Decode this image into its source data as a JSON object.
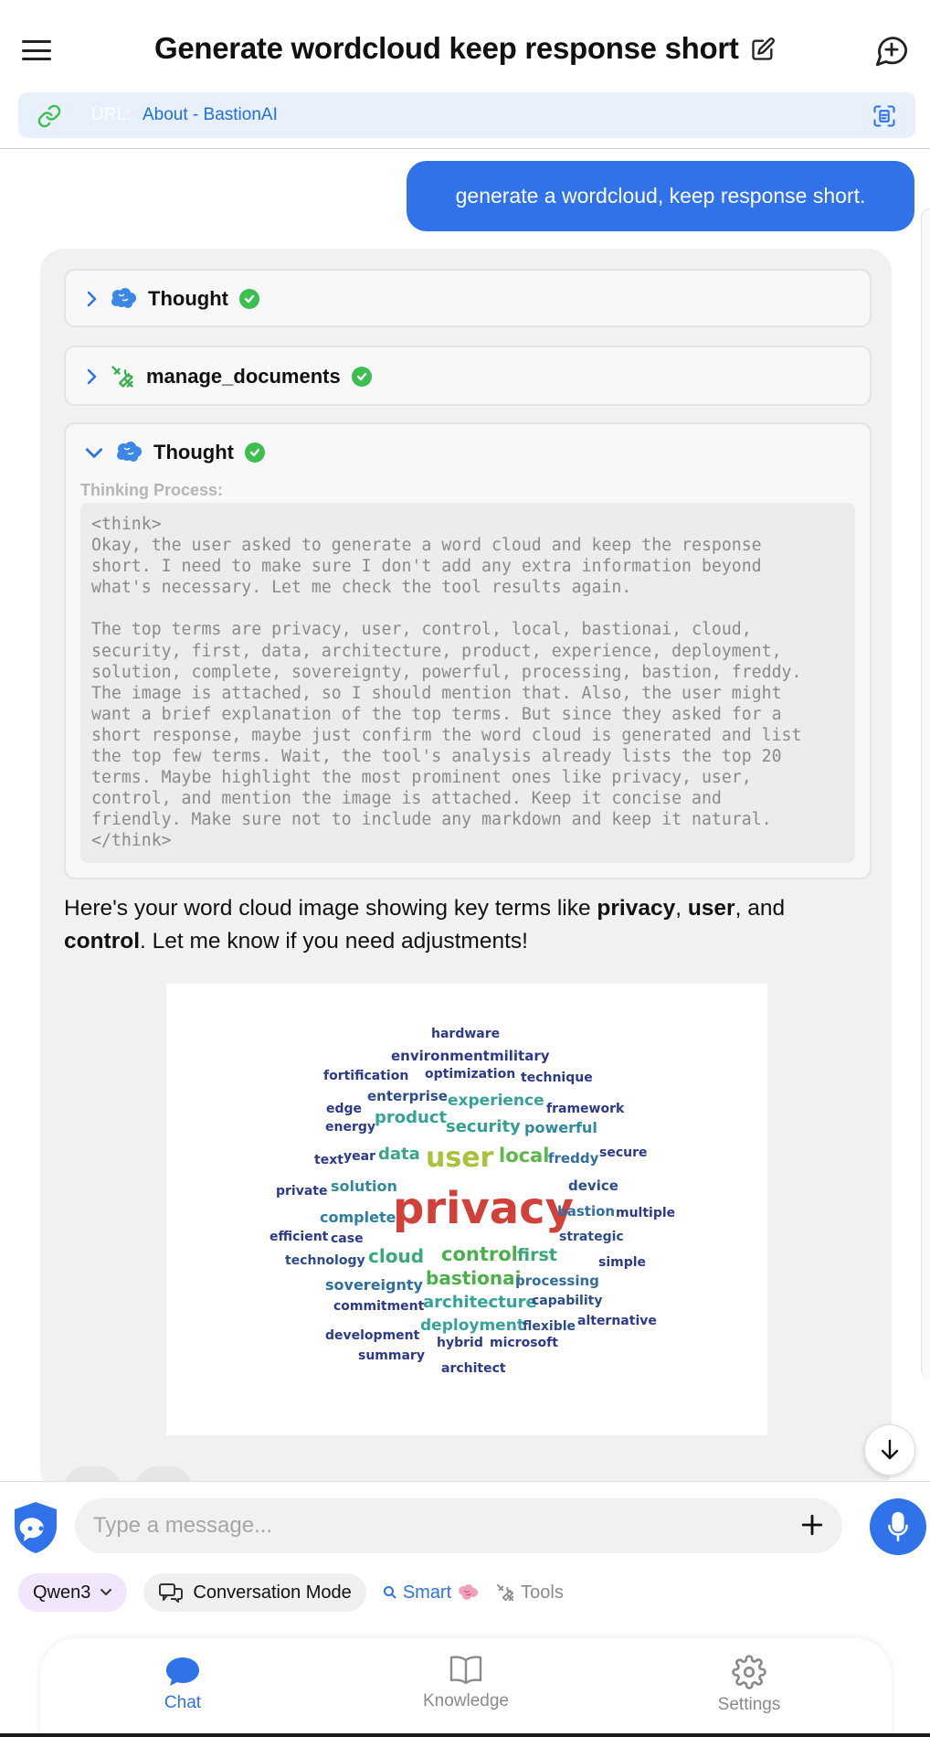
{
  "header": {
    "title": "Generate wordcloud keep response short",
    "menu_icon": "hamburger-menu-icon",
    "edit_icon": "edit-icon",
    "new_chat_icon": "new-chat-icon"
  },
  "url_bar": {
    "label": "URL:",
    "value": "About - BastionAI",
    "link_icon": "link-icon",
    "scan_icon": "scan-icon"
  },
  "user_message": "generate a wordcloud, keep response short.",
  "steps": [
    {
      "name": "Thought",
      "status": "complete",
      "expanded": false,
      "icon": "brain-icon"
    },
    {
      "name": "manage_documents",
      "status": "complete",
      "expanded": false,
      "icon": "tools-icon"
    },
    {
      "name": "Thought",
      "status": "complete",
      "expanded": true,
      "icon": "brain-icon"
    }
  ],
  "thinking": {
    "label": "Thinking Process:",
    "text": "<think>\nOkay, the user asked to generate a word cloud and keep the response\nshort. I need to make sure I don't add any extra information beyond\nwhat's necessary. Let me check the tool results again.\n\nThe top terms are privacy, user, control, local, bastionai, cloud,\nsecurity, first, data, architecture, product, experience, deployment,\nsolution, complete, sovereignty, powerful, processing, bastion, freddy.\nThe image is attached, so I should mention that. Also, the user might\nwant a brief explanation of the top terms. But since they asked for a\nshort response, maybe just confirm the word cloud is generated and list\nthe top few terms. Wait, the tool's analysis already lists the top 20\nterms. Maybe highlight the most prominent ones like privacy, user,\ncontrol, and mention the image is attached. Keep it concise and\nfriendly. Make sure not to include any markdown and keep it natural.\n</think>"
  },
  "answer": {
    "p1": "Here's your word cloud image showing key terms like ",
    "b1": "privacy",
    "p2": ", ",
    "b2": "user",
    "p3": ", and ",
    "b3": "control",
    "p4": ". Let me know if you need adjustments!"
  },
  "wordcloud": {
    "words": [
      {
        "text": "hardware",
        "color": "#2b3a8c"
      },
      {
        "text": "environment",
        "color": "#2b3a8c"
      },
      {
        "text": "military",
        "color": "#2b3a8c"
      },
      {
        "text": "fortification",
        "color": "#2b3a8c"
      },
      {
        "text": "optimization",
        "color": "#2b3a8c"
      },
      {
        "text": "technique",
        "color": "#2b3a8c"
      },
      {
        "text": "enterprise",
        "color": "#2b4d8c"
      },
      {
        "text": "edge",
        "color": "#2b3a8c"
      },
      {
        "text": "experience",
        "color": "#35a39a"
      },
      {
        "text": "framework",
        "color": "#2b3a8c"
      },
      {
        "text": "energy",
        "color": "#2b3a8c"
      },
      {
        "text": "product",
        "color": "#35a39a"
      },
      {
        "text": "security",
        "color": "#34a090"
      },
      {
        "text": "powerful",
        "color": "#2f8a9e"
      },
      {
        "text": "text",
        "color": "#2b3a8c"
      },
      {
        "text": "year",
        "color": "#2b3a8c"
      },
      {
        "text": "data",
        "color": "#38a680"
      },
      {
        "text": "user",
        "color": "#a8c23c"
      },
      {
        "text": "local",
        "color": "#5cb84a"
      },
      {
        "text": "freddy",
        "color": "#2f6e9e"
      },
      {
        "text": "secure",
        "color": "#2b3a8c"
      },
      {
        "text": "private",
        "color": "#2b3a8c"
      },
      {
        "text": "solution",
        "color": "#2f8a9e"
      },
      {
        "text": "device",
        "color": "#2b4d8c"
      },
      {
        "text": "complete",
        "color": "#2f7fa0"
      },
      {
        "text": "privacy",
        "color": "#d2403a"
      },
      {
        "text": "bastion",
        "color": "#2f6e9e"
      },
      {
        "text": "multiple",
        "color": "#2b3a8c"
      },
      {
        "text": "efficient",
        "color": "#2b3a8c"
      },
      {
        "text": "case",
        "color": "#2b3a8c"
      },
      {
        "text": "strategic",
        "color": "#2b4d8c"
      },
      {
        "text": "technology",
        "color": "#2b4d8c"
      },
      {
        "text": "cloud",
        "color": "#3aa878"
      },
      {
        "text": "control",
        "color": "#4bb04a"
      },
      {
        "text": "first",
        "color": "#3aa878"
      },
      {
        "text": "simple",
        "color": "#2b3a8c"
      },
      {
        "text": "sovereignty",
        "color": "#2f6e9e"
      },
      {
        "text": "bastionai",
        "color": "#4bb04a"
      },
      {
        "text": "processing",
        "color": "#2f6e9e"
      },
      {
        "text": "commitment",
        "color": "#2b3a8c"
      },
      {
        "text": "architecture",
        "color": "#35a39a"
      },
      {
        "text": "capability",
        "color": "#2b4d8c"
      },
      {
        "text": "deployment",
        "color": "#35a39a"
      },
      {
        "text": "flexible",
        "color": "#2b4d8c"
      },
      {
        "text": "alternative",
        "color": "#2b3a8c"
      },
      {
        "text": "development",
        "color": "#2b3a8c"
      },
      {
        "text": "hybrid",
        "color": "#2b3a8c"
      },
      {
        "text": "microsoft",
        "color": "#2b3a8c"
      },
      {
        "text": "summary",
        "color": "#2b3a8c"
      },
      {
        "text": "architect",
        "color": "#2b3a8c"
      }
    ]
  },
  "composer": {
    "placeholder": "Type a message...",
    "model": "Qwen3",
    "mode": "Conversation Mode",
    "smart": "Smart",
    "tools": "Tools"
  },
  "nav": {
    "chat": "Chat",
    "knowledge": "Knowledge",
    "settings": "Settings",
    "active": "chat"
  },
  "colors": {
    "accent": "#2f72ea",
    "success": "#3cbf4e"
  }
}
